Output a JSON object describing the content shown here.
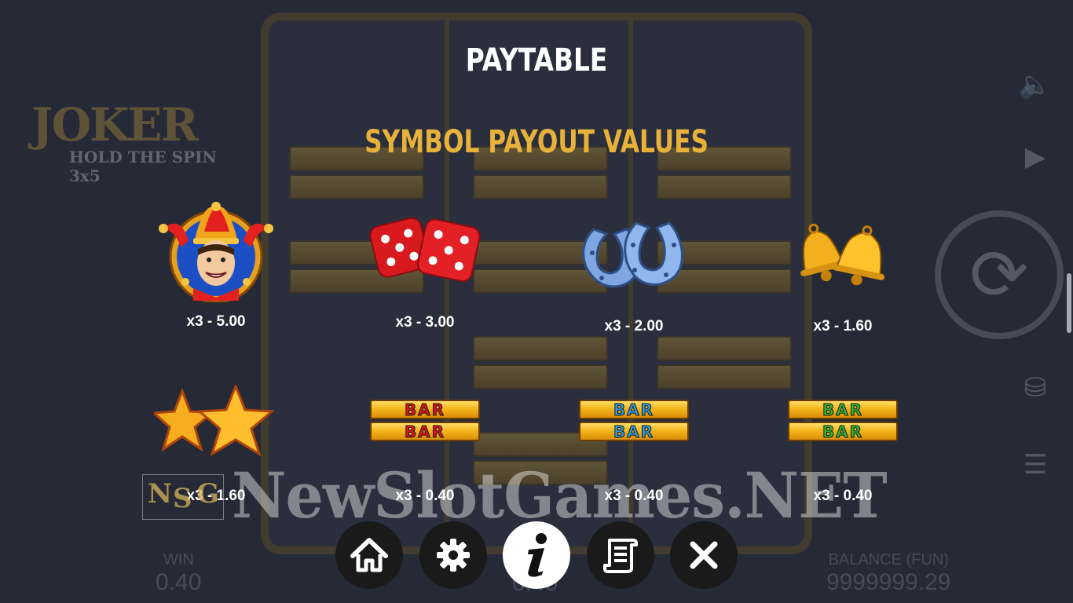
{
  "game": {
    "logo_title": "JOKER",
    "logo_subtitle": "HOLD THE SPIN",
    "logo_badge": "3x5",
    "win_label": "WIN",
    "win_value": "0.40",
    "bet_value": "0.40",
    "balance_label": "BALANCE (FUN)",
    "balance_value": "9999999.29",
    "bar_text": "BAR"
  },
  "paytable": {
    "title": "PAYTABLE",
    "subtitle": "SYMBOL PAYOUT VALUES",
    "symbols": [
      {
        "symbol": "joker-icon",
        "payout": "x3 - 5.00"
      },
      {
        "symbol": "dice-icon",
        "payout": "x3 - 3.00"
      },
      {
        "symbol": "horseshoe-icon",
        "payout": "x3 - 2.00"
      },
      {
        "symbol": "bells-icon",
        "payout": "x3 - 1.60"
      },
      {
        "symbol": "stars-icon",
        "payout": "x3 - 1.60"
      },
      {
        "symbol": "red-bar-icon",
        "bar_label": "BAR",
        "payout": "x3 - 0.40"
      },
      {
        "symbol": "blue-bar-icon",
        "bar_label": "BAR",
        "payout": "x3 - 0.40"
      },
      {
        "symbol": "green-bar-icon",
        "bar_label": "BAR",
        "payout": "x3 - 0.40"
      }
    ]
  },
  "watermark": {
    "text": "NewSlotGames.NET",
    "logo_letters": [
      "N",
      "S",
      "G"
    ]
  },
  "colors": {
    "title": "#ffffff",
    "subtitle": "#e8b23a",
    "bar_red": "#e0141b",
    "bar_blue": "#2f9bdc",
    "bar_green": "#2fb52f",
    "nav_dark": "#1a1a1a",
    "nav_active": "#ffffff"
  },
  "nav": {
    "buttons": [
      {
        "icon": "home-icon"
      },
      {
        "icon": "gear-icon"
      },
      {
        "icon": "info-icon",
        "active": true
      },
      {
        "icon": "scroll-icon"
      },
      {
        "icon": "close-icon"
      }
    ]
  }
}
